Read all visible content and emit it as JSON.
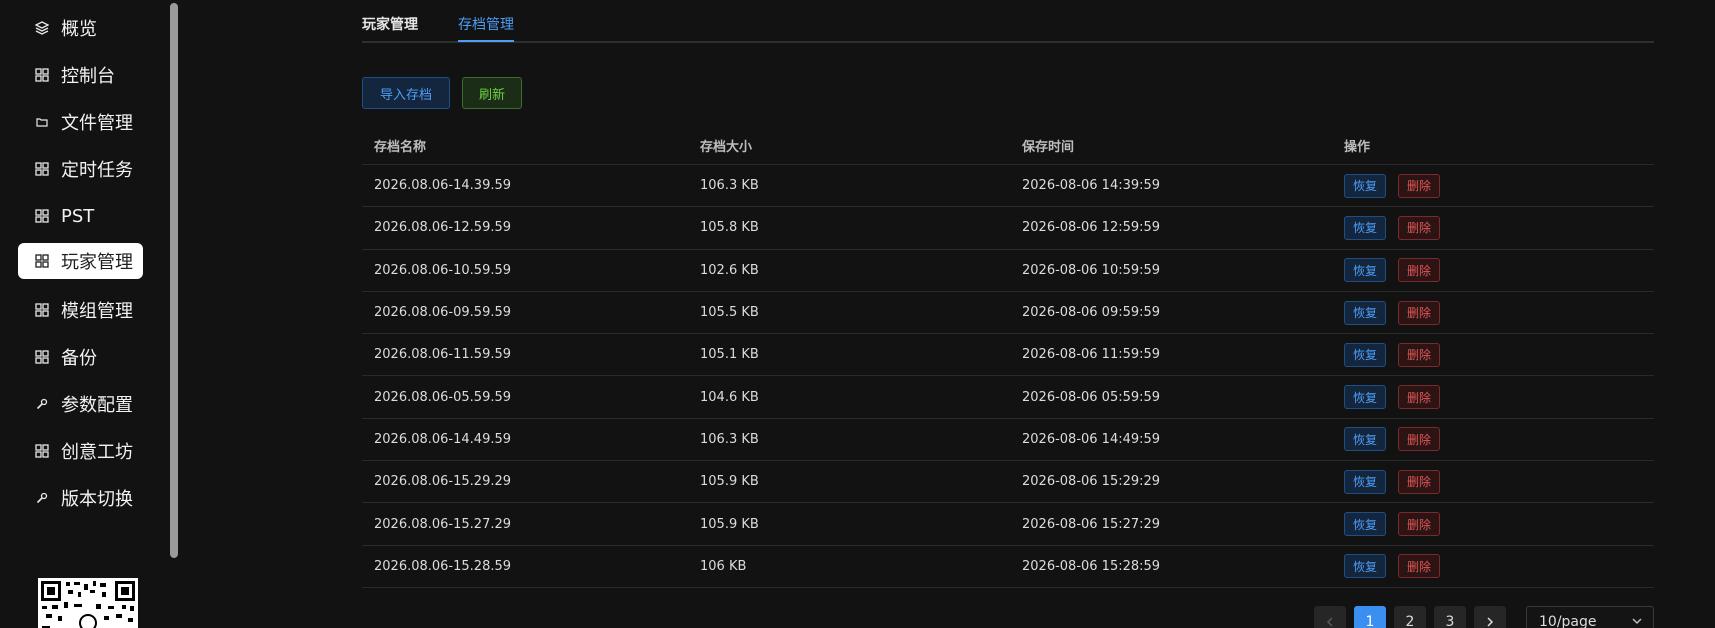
{
  "sidebar": {
    "items": [
      {
        "label": "概览",
        "icon": "layers-icon"
      },
      {
        "label": "控制台",
        "icon": "grid-icon"
      },
      {
        "label": "文件管理",
        "icon": "folder-icon"
      },
      {
        "label": "定时任务",
        "icon": "grid-icon"
      },
      {
        "label": "PST",
        "icon": "grid-icon"
      },
      {
        "label": "玩家管理",
        "icon": "grid-icon",
        "active": true
      },
      {
        "label": "模组管理",
        "icon": "grid-icon"
      },
      {
        "label": "备份",
        "icon": "grid-icon"
      },
      {
        "label": "参数配置",
        "icon": "wrench-icon"
      },
      {
        "label": "创意工坊",
        "icon": "grid-icon"
      },
      {
        "label": "版本切换",
        "icon": "wrench-icon"
      }
    ]
  },
  "tabs": [
    {
      "label": "玩家管理",
      "active": false
    },
    {
      "label": "存档管理",
      "active": true
    }
  ],
  "toolbar": {
    "import_label": "导入存档",
    "refresh_label": "刷新"
  },
  "table": {
    "columns": [
      "存档名称",
      "存档大小",
      "保存时间",
      "操作"
    ],
    "restore_label": "恢复",
    "delete_label": "删除",
    "rows": [
      {
        "name": "2026.08.06-14.39.59",
        "size": "106.3 KB",
        "time": "2026-08-06 14:39:59"
      },
      {
        "name": "2026.08.06-12.59.59",
        "size": "105.8 KB",
        "time": "2026-08-06 12:59:59"
      },
      {
        "name": "2026.08.06-10.59.59",
        "size": "102.6 KB",
        "time": "2026-08-06 10:59:59"
      },
      {
        "name": "2026.08.06-09.59.59",
        "size": "105.5 KB",
        "time": "2026-08-06 09:59:59"
      },
      {
        "name": "2026.08.06-11.59.59",
        "size": "105.1 KB",
        "time": "2026-08-06 11:59:59"
      },
      {
        "name": "2026.08.06-05.59.59",
        "size": "104.6 KB",
        "time": "2026-08-06 05:59:59"
      },
      {
        "name": "2026.08.06-14.49.59",
        "size": "106.3 KB",
        "time": "2026-08-06 14:49:59"
      },
      {
        "name": "2026.08.06-15.29.29",
        "size": "105.9 KB",
        "time": "2026-08-06 15:29:29"
      },
      {
        "name": "2026.08.06-15.27.29",
        "size": "105.9 KB",
        "time": "2026-08-06 15:27:29"
      },
      {
        "name": "2026.08.06-15.28.59",
        "size": "106 KB",
        "time": "2026-08-06 15:28:59"
      }
    ]
  },
  "pagination": {
    "pages": [
      "1",
      "2",
      "3"
    ],
    "current": "1",
    "prev_icon": "chevron-left-icon",
    "next_icon": "chevron-right-icon",
    "page_size": "10/page"
  },
  "colors": {
    "background": "#121212",
    "accent": "#4d9df7",
    "success": "#6fcf45",
    "danger": "#e05656"
  }
}
